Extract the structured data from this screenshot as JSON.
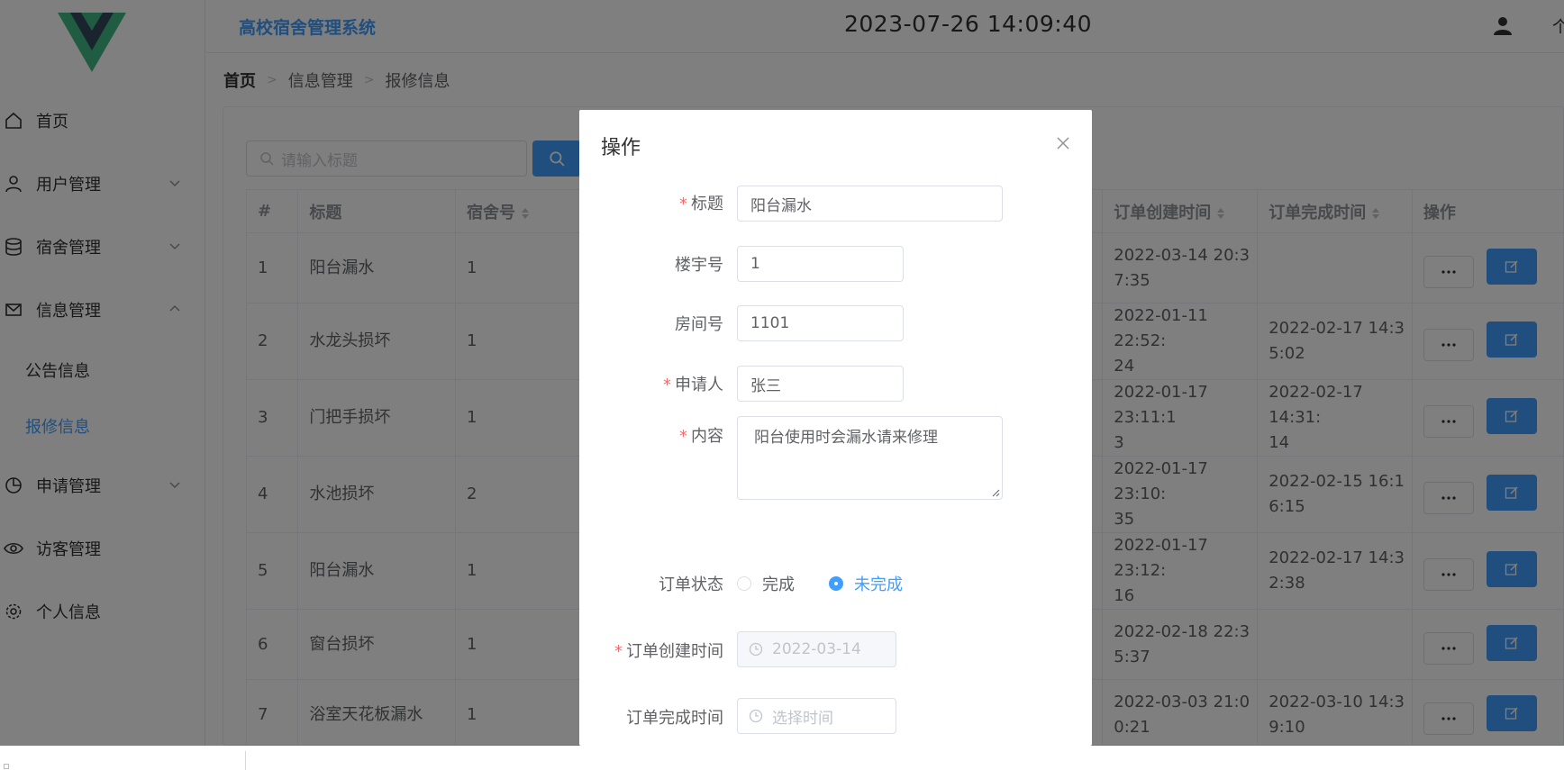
{
  "app": {
    "title": "高校宿舍管理系统",
    "clock": "2023-07-26 14:09:40",
    "user_label": "个"
  },
  "sidebar": {
    "items": [
      {
        "label": "首页",
        "icon": "home-icon"
      },
      {
        "label": "用户管理",
        "icon": "user-icon"
      },
      {
        "label": "宿舍管理",
        "icon": "database-icon"
      },
      {
        "label": "信息管理",
        "icon": "mail-icon"
      },
      {
        "label": "申请管理",
        "icon": "pie-chart-icon"
      },
      {
        "label": "访客管理",
        "icon": "eye-icon"
      },
      {
        "label": "个人信息",
        "icon": "gear-icon"
      }
    ],
    "submenu": [
      {
        "label": "公告信息"
      },
      {
        "label": "报修信息"
      }
    ]
  },
  "breadcrumb": {
    "home": "首页",
    "level1": "信息管理",
    "level2": "报修信息"
  },
  "search": {
    "placeholder": "请输入标题"
  },
  "table": {
    "headers": [
      "#",
      "标题",
      "宿舍号",
      "订单创建时间",
      "订单完成时间",
      "操作"
    ],
    "rows": [
      {
        "id": "1",
        "title": "阳台漏水",
        "dorm": "1",
        "created": "2022-03-14 20:3\n7:35",
        "done": ""
      },
      {
        "id": "2",
        "title": "水龙头损坏",
        "dorm": "1",
        "created": "2022-01-11 22:52:\n24",
        "done": "2022-02-17 14:3\n5:02"
      },
      {
        "id": "3",
        "title": "门把手损坏",
        "dorm": "1",
        "created": "2022-01-17 23:11:1\n3",
        "done": "2022-02-17 14:31:\n14"
      },
      {
        "id": "4",
        "title": "水池损坏",
        "dorm": "2",
        "created": "2022-01-17 23:10:\n35",
        "done": "2022-02-15 16:1\n6:15"
      },
      {
        "id": "5",
        "title": "阳台漏水",
        "dorm": "1",
        "created": "2022-01-17 23:12:\n16",
        "done": "2022-02-17 14:3\n2:38"
      },
      {
        "id": "6",
        "title": "窗台损坏",
        "dorm": "1",
        "created": "2022-02-18 22:3\n5:37",
        "done": ""
      },
      {
        "id": "7",
        "title": "浴室天花板漏水",
        "dorm": "1",
        "created": "2022-03-03 21:0\n0:21",
        "done": "2022-03-10 14:3\n9:10"
      }
    ]
  },
  "dialog": {
    "title": "操作",
    "fields": {
      "title_label": "标题",
      "title_value": "阳台漏水",
      "building_label": "楼宇号",
      "building_value": "1",
      "room_label": "房间号",
      "room_value": "1101",
      "applicant_label": "申请人",
      "applicant_value": "张三",
      "content_label": "内容",
      "content_value": "阳台使用时会漏水请来修理",
      "status_label": "订单状态",
      "status_option_done": "完成",
      "status_option_pending": "未完成",
      "created_label": "订单创建时间",
      "created_value": "2022-03-14",
      "finished_label": "订单完成时间",
      "finished_placeholder": "选择时间"
    }
  },
  "colors": {
    "primary": "#409eff",
    "required": "#f56c6c",
    "logo_green": "#41b883",
    "logo_dark": "#34495e"
  }
}
